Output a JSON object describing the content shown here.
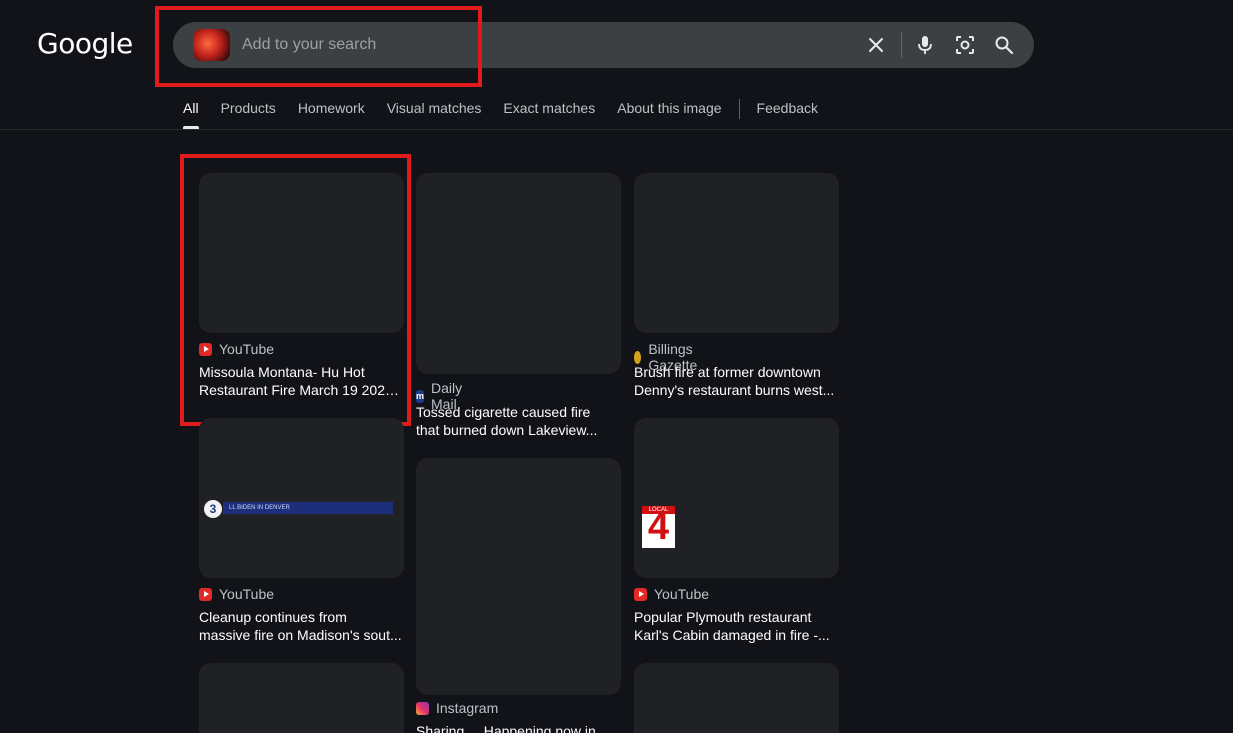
{
  "header": {
    "logo": "Google",
    "search": {
      "placeholder": "Add to your search"
    },
    "icons": [
      "clear-icon",
      "microphone-icon",
      "lens-icon",
      "search-icon"
    ]
  },
  "tabs": [
    {
      "label": "All",
      "active": true
    },
    {
      "label": "Products"
    },
    {
      "label": "Homework"
    },
    {
      "label": "Visual matches"
    },
    {
      "label": "Exact matches"
    },
    {
      "label": "About this image"
    },
    {
      "label": "Feedback"
    }
  ],
  "results": [
    {
      "source": "YouTube",
      "title_line1": "Missoula Montana- Hu Hot",
      "title_line2": "Restaurant Fire March 19 2025..."
    },
    {
      "source": "Daily Mail",
      "title_line1": "Tossed cigarette caused fire",
      "title_line2": "that burned down Lakeview..."
    },
    {
      "source": "Billings Gazette",
      "title_line1": "Brush fire at former downtown",
      "title_line2": "Denny's restaurant burns west..."
    },
    {
      "source": "YouTube",
      "title_line1": "Cleanup continues from",
      "title_line2": "massive fire on Madison's sout..."
    },
    {
      "source": "Instagram",
      "title_line1": "Sharing ... Happening now in",
      "title_line2": ""
    },
    {
      "source": "YouTube",
      "title_line1": "Popular Plymouth restaurant",
      "title_line2": "Karl's Cabin damaged in fire -..."
    }
  ],
  "overlays": {
    "local4_badge": "4",
    "local4_label": "LOCAL",
    "ch3_badge": "3",
    "ch3_bar": "LL BIDEN IN DENVER"
  },
  "colors": {
    "background": "#121318",
    "search_bg": "#3c4043",
    "highlight_box": "#e01b1b",
    "youtube": "#e32828"
  }
}
